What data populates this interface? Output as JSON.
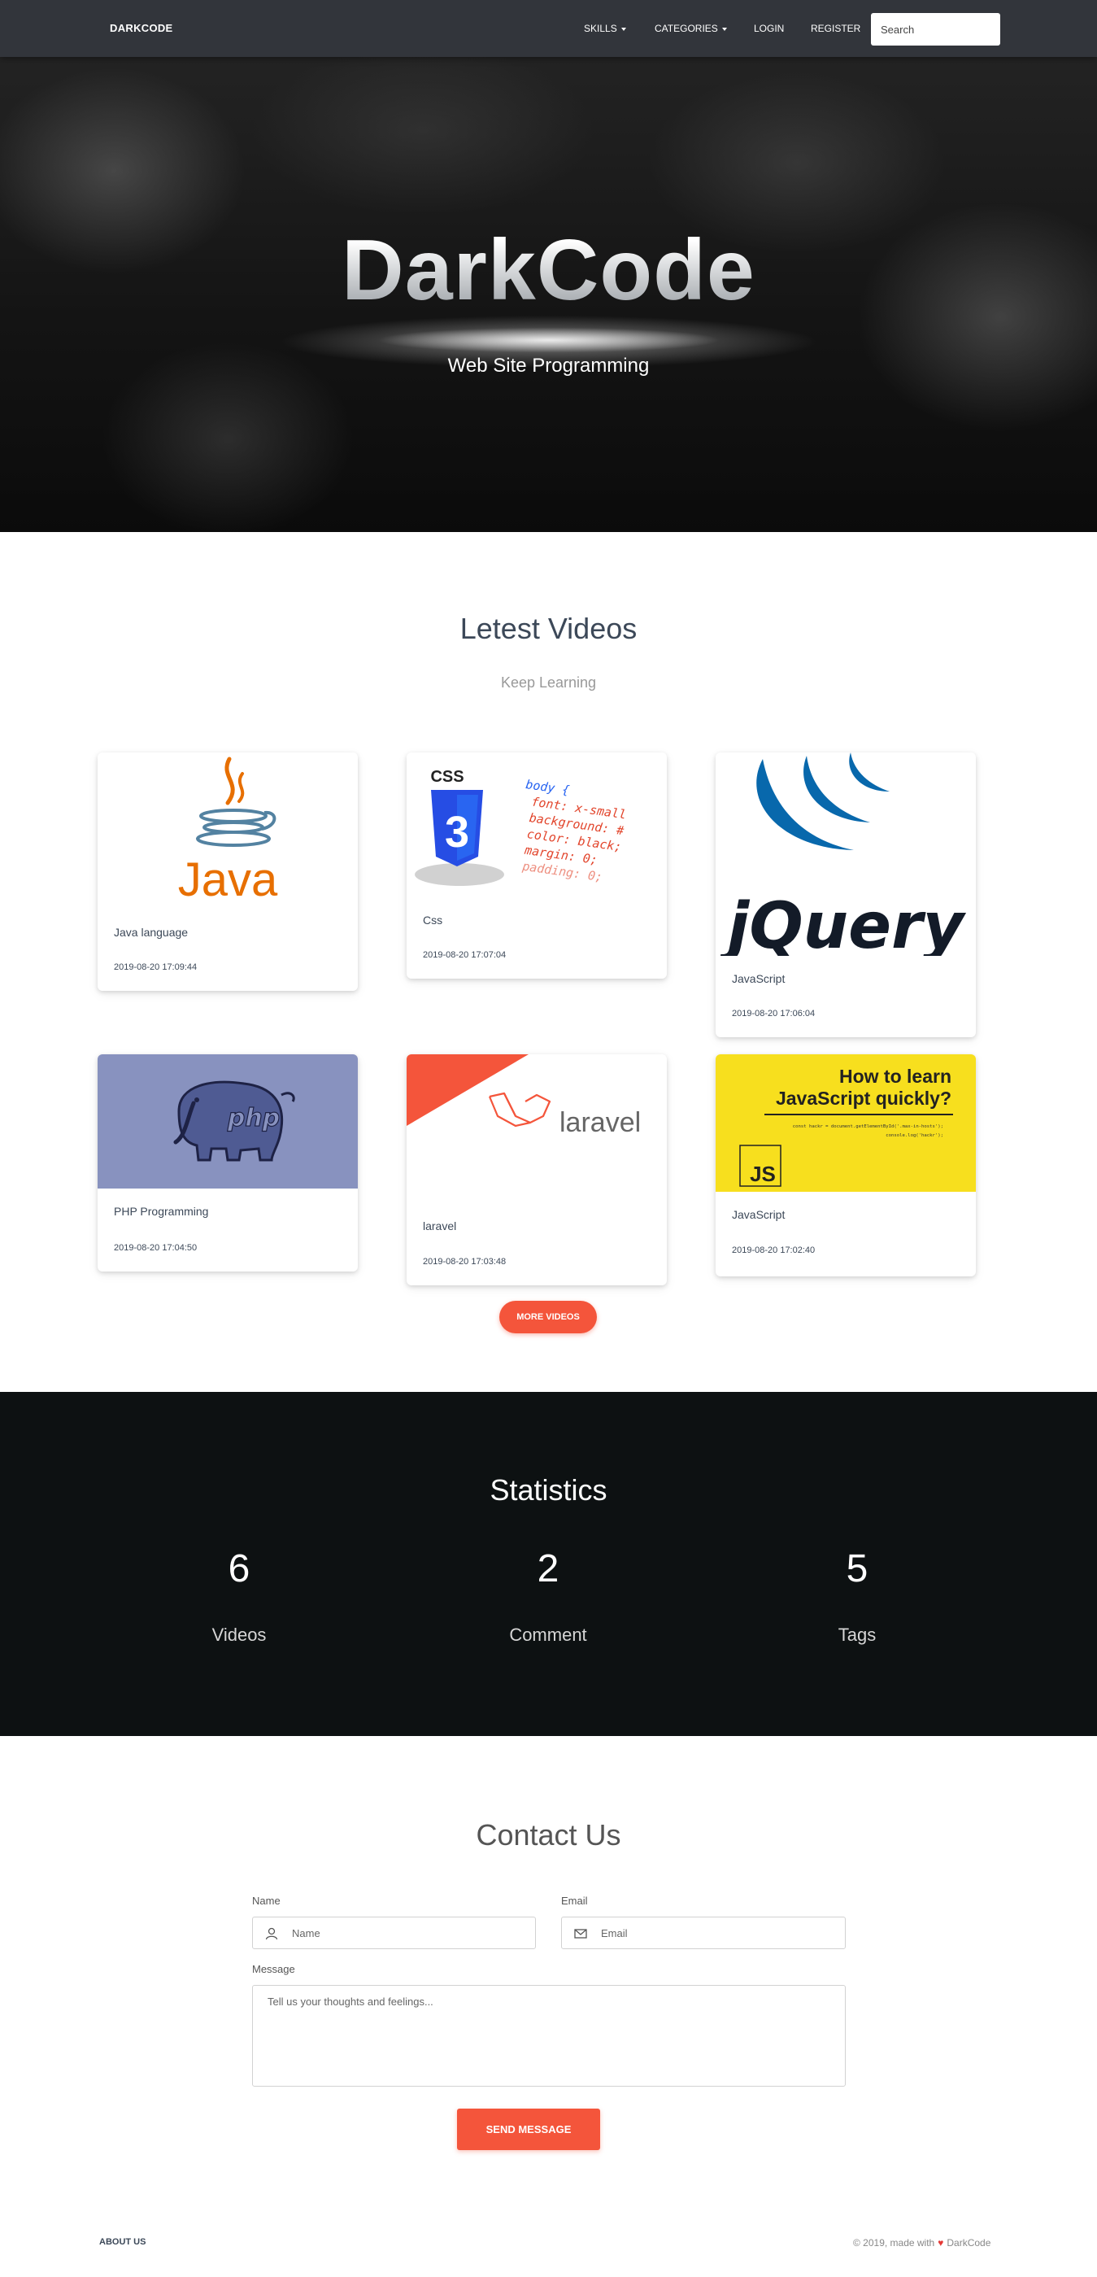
{
  "navbar": {
    "brand": "DARKCODE",
    "links": [
      {
        "label": "SKILLS",
        "dropdown": true
      },
      {
        "label": "CATEGORIES",
        "dropdown": true
      },
      {
        "label": "LOGIN",
        "dropdown": false
      },
      {
        "label": "REGISTER",
        "dropdown": false
      }
    ],
    "search_placeholder": "Search"
  },
  "hero": {
    "title": "DarkCode",
    "subtitle": "Web Site Programming"
  },
  "latest": {
    "title": "Letest Videos",
    "subtitle": "Keep Learning",
    "cards": [
      {
        "title": "Java language",
        "date": "2019-08-20 17:09:44",
        "image": "java-logo"
      },
      {
        "title": "Css",
        "date": "2019-08-20 17:07:04",
        "image": "css3-logo"
      },
      {
        "title": "JavaScript",
        "date": "2019-08-20 17:06:04",
        "image": "jquery-logo"
      },
      {
        "title": "PHP Programming",
        "date": "2019-08-20 17:04:50",
        "image": "php-elephant"
      },
      {
        "title": "laravel",
        "date": "2019-08-20 17:03:48",
        "image": "laravel-logo"
      },
      {
        "title": "JavaScript",
        "date": "2019-08-20 17:02:40",
        "image": "js-howto-banner"
      }
    ],
    "more_button": "MORE VIDEOS",
    "image_text": {
      "java_word": "Java",
      "css_badge": "CSS",
      "css_num": "3",
      "css_code": [
        "body {",
        "  font: x-small",
        "  background: #",
        "  color: black;",
        "  margin: 0;",
        "  padding: 0;"
      ],
      "jquery_word": "jQuery",
      "php_word": "php",
      "laravel_word": "laravel",
      "js_headline": [
        "How to learn",
        "JavaScript quickly?"
      ],
      "js_code": [
        "const hackr = document.getElementById('.max-in-hosts');",
        "console.log('hackr');"
      ],
      "js_badge": "JS"
    }
  },
  "stats": {
    "title": "Statistics",
    "items": [
      {
        "value": "6",
        "label": "Videos"
      },
      {
        "value": "2",
        "label": "Comment"
      },
      {
        "value": "5",
        "label": "Tags"
      }
    ]
  },
  "contact": {
    "title": "Contact Us",
    "name_label": "Name",
    "name_placeholder": "Name",
    "email_label": "Email",
    "email_placeholder": "Email",
    "message_label": "Message",
    "message_placeholder": "Tell us your thoughts and feelings...",
    "send_button": "SEND MESSAGE"
  },
  "footer": {
    "left_link": "ABOUT US",
    "copyright": "© 2019, made with",
    "heart": "♥",
    "brand": "DarkCode"
  },
  "colors": {
    "navbar": "#32353b",
    "accent": "#f4553b",
    "stats_bg": "#0d1112"
  }
}
